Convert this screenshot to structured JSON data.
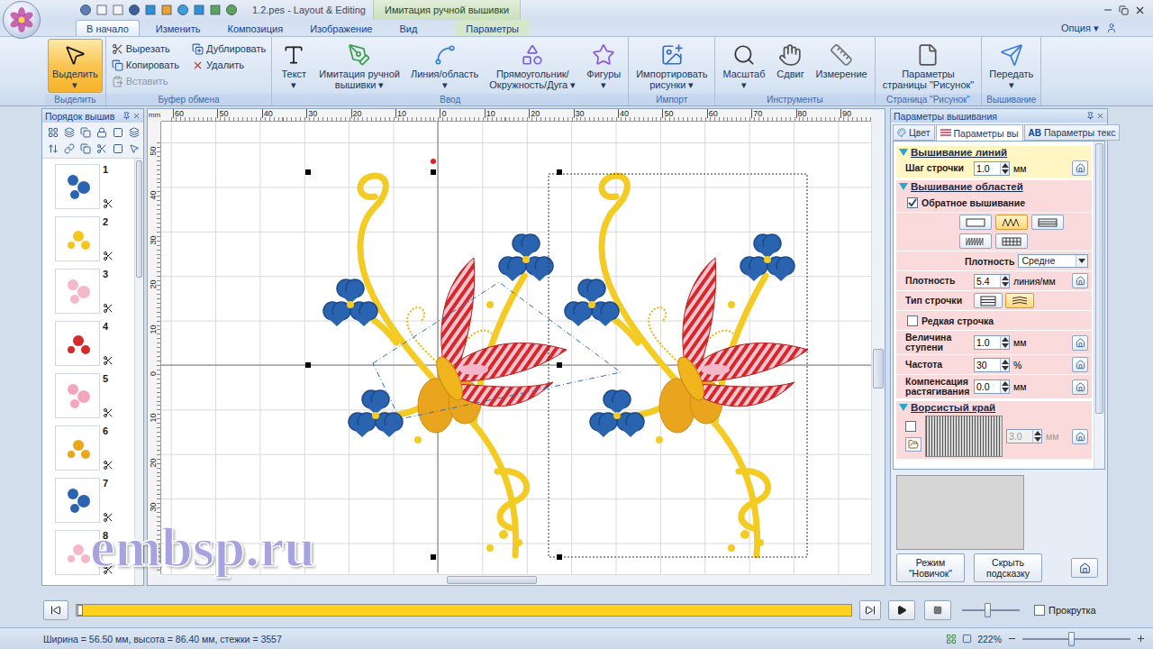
{
  "window": {
    "title": "1.2.pes - Layout & Editing",
    "context_tab": "Имитация ручной вышивки"
  },
  "tabs": [
    {
      "label": "В начало",
      "selected": true,
      "contextual": false
    },
    {
      "label": "Изменить",
      "selected": false,
      "contextual": false
    },
    {
      "label": "Композиция",
      "selected": false,
      "contextual": false
    },
    {
      "label": "Изображение",
      "selected": false,
      "contextual": false
    },
    {
      "label": "Вид",
      "selected": false,
      "contextual": false
    },
    {
      "label": "Параметры",
      "selected": false,
      "contextual": true
    }
  ],
  "options_menu": "Опция ▾",
  "ribbon": [
    {
      "label": "Выделить",
      "buttons": [
        {
          "lines": [
            "Выделить",
            "▾"
          ],
          "kind": "large",
          "selected": true,
          "disabled": false
        }
      ]
    },
    {
      "label": "Буфер обмена",
      "buttons": [
        {
          "lines": [
            "Вырезать"
          ],
          "kind": "small",
          "selected": false,
          "disabled": false
        },
        {
          "lines": [
            "Копировать"
          ],
          "kind": "small",
          "selected": false,
          "disabled": false
        },
        {
          "lines": [
            "Вставить"
          ],
          "kind": "small",
          "selected": false,
          "disabled": true
        },
        {
          "lines": [
            "Дублировать"
          ],
          "kind": "small",
          "selected": false,
          "disabled": false
        },
        {
          "lines": [
            "Удалить"
          ],
          "kind": "small",
          "selected": false,
          "disabled": false
        }
      ]
    },
    {
      "label": "Ввод",
      "buttons": [
        {
          "lines": [
            "Текст",
            "▾"
          ],
          "kind": "large",
          "selected": false,
          "disabled": false
        },
        {
          "lines": [
            "Имитация ручной",
            "вышивки ▾"
          ],
          "kind": "large",
          "selected": false,
          "disabled": false
        },
        {
          "lines": [
            "Линия/область",
            "▾"
          ],
          "kind": "large",
          "selected": false,
          "disabled": false
        },
        {
          "lines": [
            "Прямоугольник/",
            "Окружность/Дуга ▾"
          ],
          "kind": "large",
          "selected": false,
          "disabled": false
        },
        {
          "lines": [
            "Фигуры",
            "▾"
          ],
          "kind": "large",
          "selected": false,
          "disabled": false
        }
      ]
    },
    {
      "label": "Импорт",
      "buttons": [
        {
          "lines": [
            "Импортировать",
            "рисунки ▾"
          ],
          "kind": "large",
          "selected": false,
          "disabled": false
        }
      ]
    },
    {
      "label": "Инструменты",
      "buttons": [
        {
          "lines": [
            "Масштаб",
            "▾"
          ],
          "kind": "large",
          "selected": false,
          "disabled": false
        },
        {
          "lines": [
            "Сдвиг"
          ],
          "kind": "large",
          "selected": false,
          "disabled": false
        },
        {
          "lines": [
            "Измерение"
          ],
          "kind": "large",
          "selected": false,
          "disabled": false
        }
      ]
    },
    {
      "label": "Страница \"Рисунок\"",
      "buttons": [
        {
          "lines": [
            "Параметры",
            "страницы \"Рисунок\""
          ],
          "kind": "large",
          "selected": false,
          "disabled": false
        }
      ]
    },
    {
      "label": "Вышивание",
      "buttons": [
        {
          "lines": [
            "Передать",
            "▾"
          ],
          "kind": "large",
          "selected": false,
          "disabled": false
        }
      ]
    }
  ],
  "sew_order": {
    "title": "Порядок вышив",
    "items": [
      {
        "number": "1",
        "color": "#2a64b0"
      },
      {
        "number": "2",
        "color": "#f2c81e"
      },
      {
        "number": "3",
        "color": "#f4b8c8"
      },
      {
        "number": "4",
        "color": "#d42a2a"
      },
      {
        "number": "5",
        "color": "#f4a6bd"
      },
      {
        "number": "6",
        "color": "#e8a81a"
      },
      {
        "number": "7",
        "color": "#2a64b0"
      },
      {
        "number": "8",
        "color": "#f4b8c8"
      }
    ],
    "scroll": {
      "level": 0.0
    }
  },
  "canvas": {
    "units": "mm",
    "ruler_x": [
      "60",
      "50",
      "40",
      "30",
      "20",
      "10",
      "0",
      "10",
      "20",
      "30",
      "40",
      "50",
      "60",
      "70",
      "80",
      "90"
    ],
    "ruler_y": [
      "50",
      "40",
      "30",
      "20",
      "10",
      "0",
      "10",
      "20",
      "30",
      "40"
    ],
    "h_scroll": {
      "level": 0.46
    },
    "v_scroll": {
      "level": 0.55
    },
    "watermark": "embsp.ru"
  },
  "params": {
    "title": "Параметры вышивания",
    "tabs": [
      {
        "label": "Цвет",
        "badge": "",
        "selected": false
      },
      {
        "label": "Параметры вы",
        "badge": "",
        "selected": true
      },
      {
        "label": "Параметры текс",
        "badge": "AB",
        "selected": false
      }
    ],
    "sections": [
      {
        "title": "Вышивание линий",
        "expanded": true,
        "color": "#fff6c4",
        "rows": [
          {
            "kind": "spin",
            "label": [
              "Шаг строчки"
            ],
            "value": "1.0",
            "unit": "мм",
            "disabled": false
          }
        ]
      },
      {
        "title": "Вышивание областей",
        "expanded": true,
        "color": "#fbdadc",
        "rows": [
          {
            "kind": "check",
            "label": "Обратное вышивание",
            "checked": true
          },
          {
            "kind": "fill-types",
            "options": [
              {
                "selected": false
              },
              {
                "selected": true
              },
              {
                "selected": false
              },
              {
                "selected": false
              },
              {
                "selected": false
              }
            ]
          },
          {
            "kind": "select",
            "label": "Плотность",
            "value": "Средне"
          },
          {
            "kind": "spin",
            "label": [
              "Плотность"
            ],
            "value": "5.4",
            "unit": "линия/мм",
            "disabled": false
          },
          {
            "kind": "toggle",
            "label": "Тип строчки",
            "options": [
              {
                "selected": false
              },
              {
                "selected": true
              }
            ]
          },
          {
            "kind": "check",
            "label": "Редкая строчка",
            "checked": false
          },
          {
            "kind": "spin",
            "label": [
              "Величина",
              "ступени"
            ],
            "value": "1.0",
            "unit": "мм",
            "disabled": false
          },
          {
            "kind": "spin",
            "label": [
              "Частота"
            ],
            "value": "30",
            "unit": "%",
            "disabled": false
          },
          {
            "kind": "spin",
            "label": [
              "Компенсация",
              "растягивания"
            ],
            "value": "0.0",
            "unit": "мм",
            "disabled": false
          }
        ]
      },
      {
        "title": "Ворсистый край",
        "expanded": true,
        "color": "#fbdadc",
        "rows": [
          {
            "kind": "fringe",
            "checked": false,
            "value": "3.0",
            "unit": "мм",
            "disabled": true
          }
        ]
      }
    ],
    "buttons": [
      {
        "lines": [
          "Режим",
          "\"Новичок\""
        ]
      },
      {
        "lines": [
          "Скрыть",
          "подсказку"
        ]
      }
    ]
  },
  "playback": {
    "level": 0.0,
    "speed": {
      "level": 0.44
    },
    "scroll": {
      "label": "Прокрутка",
      "checked": false
    }
  },
  "status_bar": {
    "text": "Ширина = 56.50 мм, высота = 86.40 мм, стежки = 3557",
    "zoom": "222%",
    "zoom_slider": {
      "level": 0.45
    }
  }
}
